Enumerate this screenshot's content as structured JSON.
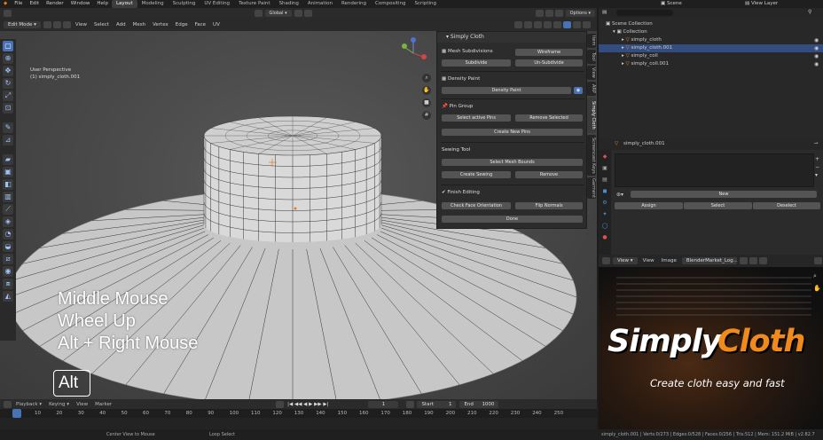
{
  "topbar": {
    "menu": [
      "File",
      "Edit",
      "Render",
      "Window",
      "Help"
    ],
    "workspaces": [
      "Layout",
      "Modeling",
      "Sculpting",
      "UV Editing",
      "Texture Paint",
      "Shading",
      "Animation",
      "Rendering",
      "Compositing",
      "Scripting"
    ],
    "active_workspace": "Layout",
    "scene": "Scene",
    "view_layer": "View Layer"
  },
  "viewport_header": {
    "mode": "Edit Mode",
    "menus": [
      "View",
      "Select",
      "Add",
      "Mesh",
      "Vertex",
      "Edge",
      "Face",
      "UV"
    ],
    "orientation": "Global",
    "options": "Options"
  },
  "viewport": {
    "view_name": "User Perspective",
    "object_name": "(1) simply_cloth.001",
    "overlay_lines": [
      "Middle Mouse",
      "Wheel Up",
      "Alt + Right Mouse"
    ],
    "key_badge": "Alt"
  },
  "cloth_panel": {
    "title": "Simply Cloth",
    "mesh_subdivisions": "Mesh Subdivisions",
    "wireframe": "Wireframe",
    "subdivide": "Subdivide",
    "un_subdivide": "Un-Subdivide",
    "density_paint_section": "Density Paint",
    "density_paint_btn": "Density Paint",
    "pin_group": "Pin Group",
    "select_active_pins": "Select active Pins",
    "remove_selected": "Remove Selected",
    "create_new_pins": "Create New Pins",
    "sewing_tool": "Sewing Tool",
    "select_mesh_bounds": "Select Mesh Bounds",
    "create_sewing": "Create Sewing",
    "remove": "Remove",
    "finish_editing": "Finish Editing",
    "check_face_orientation": "Check Face Orientation",
    "flip_normals": "Flip Normals",
    "done": "Done"
  },
  "side_tabs": [
    "Item",
    "Tool",
    "View",
    "ARP",
    "Simply Cloth",
    "Screencast Keys",
    "Garment"
  ],
  "timeline": {
    "menus": [
      "Playback",
      "Keying",
      "View",
      "Marker"
    ],
    "current_frame": "1",
    "start_label": "Start",
    "start": "1",
    "end_label": "End",
    "end": "1000",
    "ruler": [
      "1",
      "10",
      "20",
      "30",
      "40",
      "50",
      "60",
      "70",
      "80",
      "90",
      "100",
      "110",
      "120",
      "130",
      "140",
      "150",
      "160",
      "170",
      "180",
      "190",
      "200",
      "210",
      "220",
      "230",
      "240",
      "250"
    ]
  },
  "status": {
    "hint1": "Center View to Mouse",
    "hint2": "Loop Select",
    "stats": "simply_cloth.001 | Verts:0/273 | Edges:0/528 | Faces:0/256 | Tris:512 | Mem: 151.2 MiB | v2.82.7"
  },
  "outliner": {
    "scene_collection": "Scene Collection",
    "collection": "Collection",
    "items": [
      {
        "name": "simply_cloth",
        "selected": false
      },
      {
        "name": "simply_cloth.001",
        "selected": true
      },
      {
        "name": "simply_coll",
        "selected": false
      },
      {
        "name": "simply_coll.001",
        "selected": false
      }
    ]
  },
  "properties": {
    "object": "simply_cloth.001",
    "new_btn": "New",
    "assign": "Assign",
    "select": "Select",
    "deselect": "Deselect"
  },
  "image_editor": {
    "menus": [
      "View",
      "View",
      "Image"
    ],
    "image_name": "BlenderMarket_Log...",
    "brand_word1": "Simply",
    "brand_word2": "Cloth",
    "tagline": "Create cloth easy and fast"
  },
  "colors": {
    "accent": "#4772b3",
    "brand_orange": "#f08a1c"
  }
}
